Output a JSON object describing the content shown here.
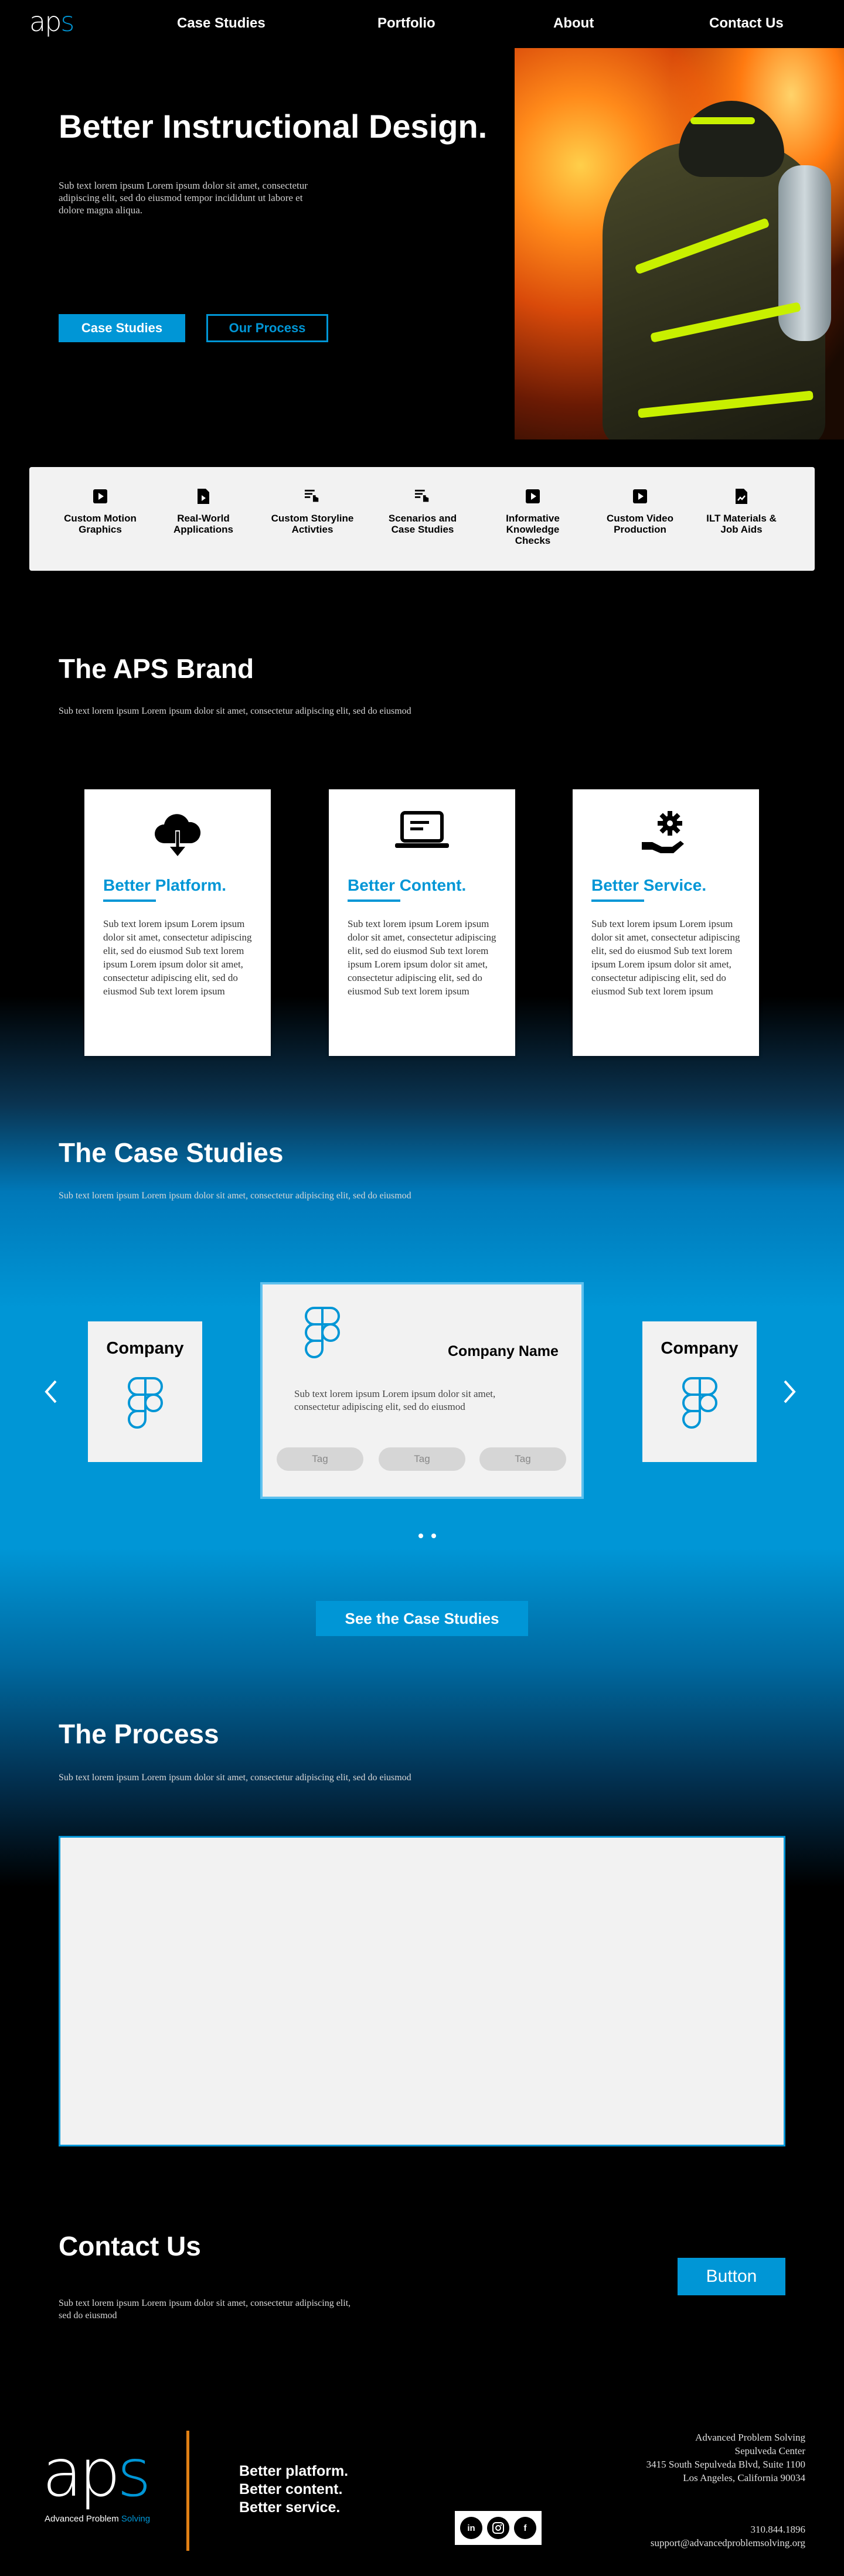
{
  "nav": {
    "logo_ap": "ap",
    "logo_s": "s",
    "links": [
      "Case Studies",
      "Portfolio",
      "About",
      "Contact Us"
    ]
  },
  "hero": {
    "title": "Better Instructional Design.",
    "subtitle": "Sub text lorem ipsum Lorem ipsum dolor sit amet, consectetur adipiscing elit, sed do eiusmod tempor incididunt ut labore et dolore magna aliqua.",
    "primary_button": "Case Studies",
    "secondary_button": "Our Process"
  },
  "services": [
    {
      "icon": "play-icon",
      "label": "Custom Motion Graphics"
    },
    {
      "icon": "document-play-icon",
      "label": "Real-World Applications"
    },
    {
      "icon": "list-pointer-icon",
      "label": "Custom Storyline Activties"
    },
    {
      "icon": "list-pointer-icon",
      "label": "Scenarios and Case Studies"
    },
    {
      "icon": "play-icon",
      "label": "Informative Knowledge Checks"
    },
    {
      "icon": "play-icon",
      "label": "Custom Video Production"
    },
    {
      "icon": "document-chart-icon",
      "label": "ILT Materials & Job Aids"
    }
  ],
  "brand": {
    "title": "The APS Brand",
    "subtitle": "Sub text lorem ipsum Lorem ipsum dolor sit amet, consectetur adipiscing elit, sed do eiusmod",
    "cards": [
      {
        "icon": "cloud-download-icon",
        "title": "Better Platform.",
        "body": "Sub text lorem ipsum Lorem ipsum dolor sit amet, consectetur adipiscing elit, sed do eiusmod Sub text lorem ipsum Lorem ipsum dolor sit amet, consectetur adipiscing elit, sed do eiusmod Sub text lorem ipsum"
      },
      {
        "icon": "laptop-icon",
        "title": "Better Content.",
        "body": "Sub text lorem ipsum Lorem ipsum dolor sit amet, consectetur adipiscing elit, sed do eiusmod Sub text lorem ipsum Lorem ipsum dolor sit amet, consectetur adipiscing elit, sed do eiusmod Sub text lorem ipsum"
      },
      {
        "icon": "hand-gear-icon",
        "title": "Better Service.",
        "body": "Sub text lorem ipsum Lorem ipsum dolor sit amet, consectetur adipiscing elit, sed do eiusmod Sub text lorem ipsum Lorem ipsum dolor sit amet, consectetur adipiscing elit, sed do eiusmod Sub text lorem ipsum"
      }
    ]
  },
  "cases": {
    "title": "The Case Studies",
    "subtitle": "Sub text lorem ipsum Lorem ipsum dolor sit amet, consectetur adipiscing elit, sed do eiusmod",
    "left_card": "Company",
    "right_card": "Company",
    "main_card": {
      "name": "Company Name",
      "body": "Sub text lorem ipsum Lorem ipsum dolor sit amet, consectetur adipiscing elit, sed do eiusmod",
      "tags": [
        "Tag",
        "Tag",
        "Tag"
      ]
    },
    "button": "See the Case Studies",
    "prev_icon": "chevron-left-icon",
    "next_icon": "chevron-right-icon"
  },
  "process": {
    "title": "The Process",
    "subtitle": "Sub text lorem ipsum Lorem ipsum dolor sit amet, consectetur adipiscing elit, sed do eiusmod"
  },
  "contact": {
    "title": "Contact Us",
    "subtitle": "Sub text lorem ipsum Lorem ipsum dolor sit amet, consectetur adipiscing elit, sed do eiusmod",
    "button": "Button"
  },
  "footer": {
    "logo_ap": "ap",
    "logo_s": "s",
    "logo_sub_a": "Advanced Problem",
    "logo_sub_b": "Solving",
    "tagline": [
      "Better platform.",
      "Better content.",
      "Better service."
    ],
    "socials": [
      "in",
      "ig",
      "f"
    ],
    "address": [
      "Advanced Problem Solving",
      "Sepulveda Center",
      "3415 South Sepulveda Blvd, Suite 1100",
      "Los Angeles, California 90034"
    ],
    "phone": "310.844.1896",
    "email": "support@advancedproblemsolving.org"
  },
  "colors": {
    "accent": "#0096d6",
    "divider": "#e07f14",
    "card_bg": "#f2f2f2"
  }
}
